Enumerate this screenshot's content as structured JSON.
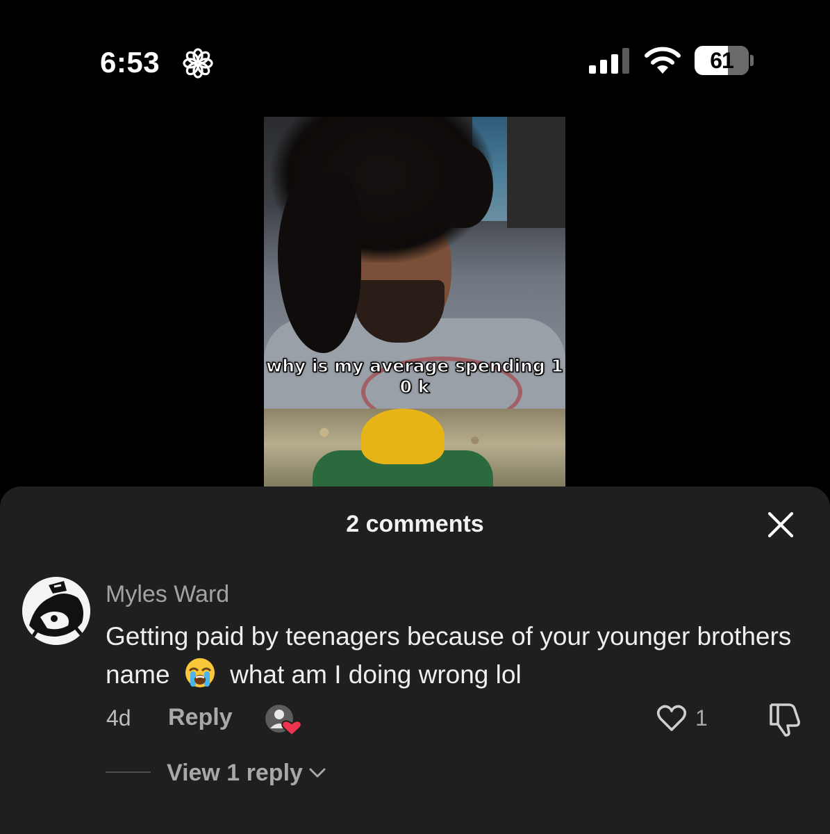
{
  "status_bar": {
    "time": "6:53",
    "battery_level": "61",
    "battery_fraction": 0.61,
    "signal_bars_active": 3,
    "signal_bars_total": 4,
    "icons": [
      "flower-icon",
      "signal-icon",
      "wifi-icon",
      "battery-icon"
    ]
  },
  "video": {
    "caption_line1": "why is my average spending 1",
    "caption_line2": "0 k"
  },
  "comments_sheet": {
    "title": "2 comments",
    "close_icon": "close-icon"
  },
  "comments": [
    {
      "username": "Myles Ward",
      "text_before_emoji": "Getting paid by teenagers because of your younger brothers name",
      "emoji": "loudly-crying-face",
      "text_after_emoji": "what am I doing wrong lol",
      "age": "4d",
      "reply_label": "Reply",
      "like_count": "1",
      "view_replies_label": "View 1 reply"
    }
  ],
  "colors": {
    "background": "#000000",
    "sheet": "#1f1f1f",
    "primary_text": "#efefef",
    "secondary_text": "#a8a8a8",
    "heart_red": "#f0334e"
  }
}
